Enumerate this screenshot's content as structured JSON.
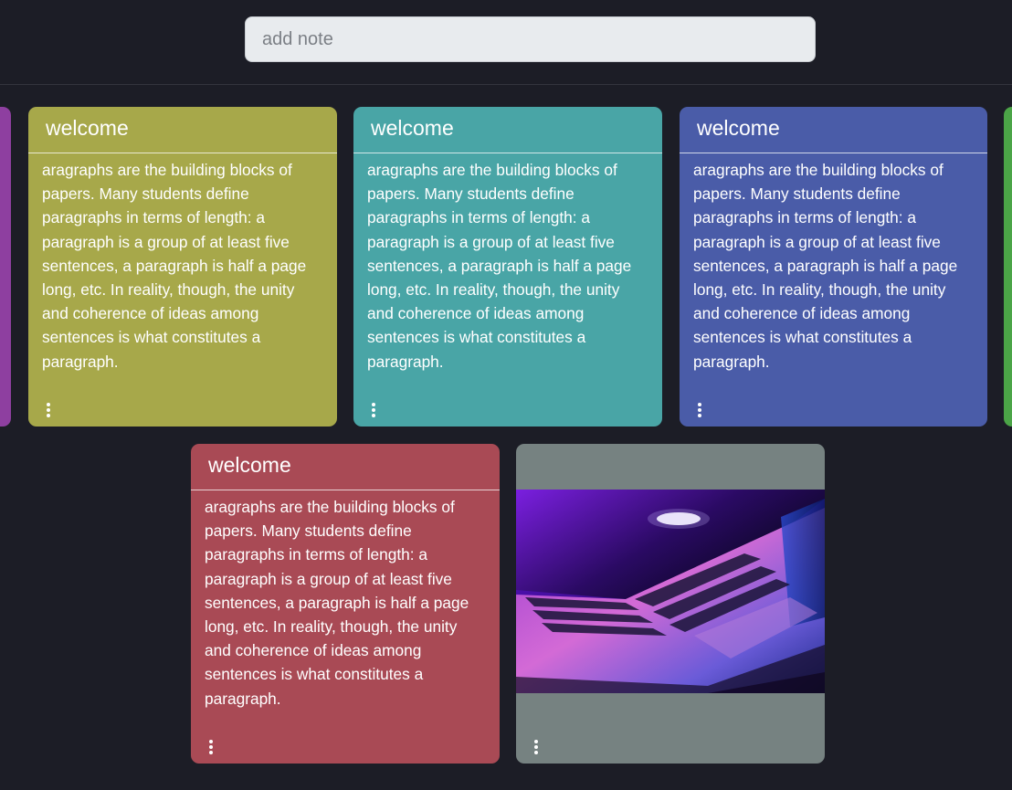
{
  "search": {
    "placeholder": "add note"
  },
  "colors": {
    "background": "#1c1d26",
    "purple": "#8e3fa0",
    "olive": "#a7a84a",
    "teal": "#49a5a6",
    "indigo": "#4a5ca8",
    "green": "#4ba447",
    "red": "#a94a55",
    "gray": "#768281"
  },
  "notes": [
    {
      "title": "welcome",
      "body": "aragraphs are the building blocks of papers. Many students define paragraphs in terms of length: a paragraph is a group of at least five sentences, a paragraph is half a page long, etc. In reality, though, the unity and coherence of ideas among sentences is what constitutes a paragraph.",
      "color": "#a7a84a"
    },
    {
      "title": "welcome",
      "body": "aragraphs are the building blocks of papers. Many students define paragraphs in terms of length: a paragraph is a group of at least five sentences, a paragraph is half a page long, etc. In reality, though, the unity and coherence of ideas among sentences is what constitutes a paragraph.",
      "color": "#49a5a6"
    },
    {
      "title": "welcome",
      "body": "aragraphs are the building blocks of papers. Many students define paragraphs in terms of length: a paragraph is a group of at least five sentences, a paragraph is half a page long, etc. In reality, though, the unity and coherence of ideas among sentences is what constitutes a paragraph.",
      "color": "#4a5ca8"
    },
    {
      "title": "welcome",
      "body": "aragraphs are the building blocks of papers. Many students define paragraphs in terms of length: a paragraph is a group of at least five sentences, a paragraph is half a page long, etc. In reality, though, the unity and coherence of ideas among sentences is what constitutes a paragraph.",
      "color": "#a94a55"
    }
  ],
  "image_note": {
    "image": "laptop-photo",
    "color": "#768281"
  },
  "icons": {
    "menu": "more-vertical-icon"
  }
}
